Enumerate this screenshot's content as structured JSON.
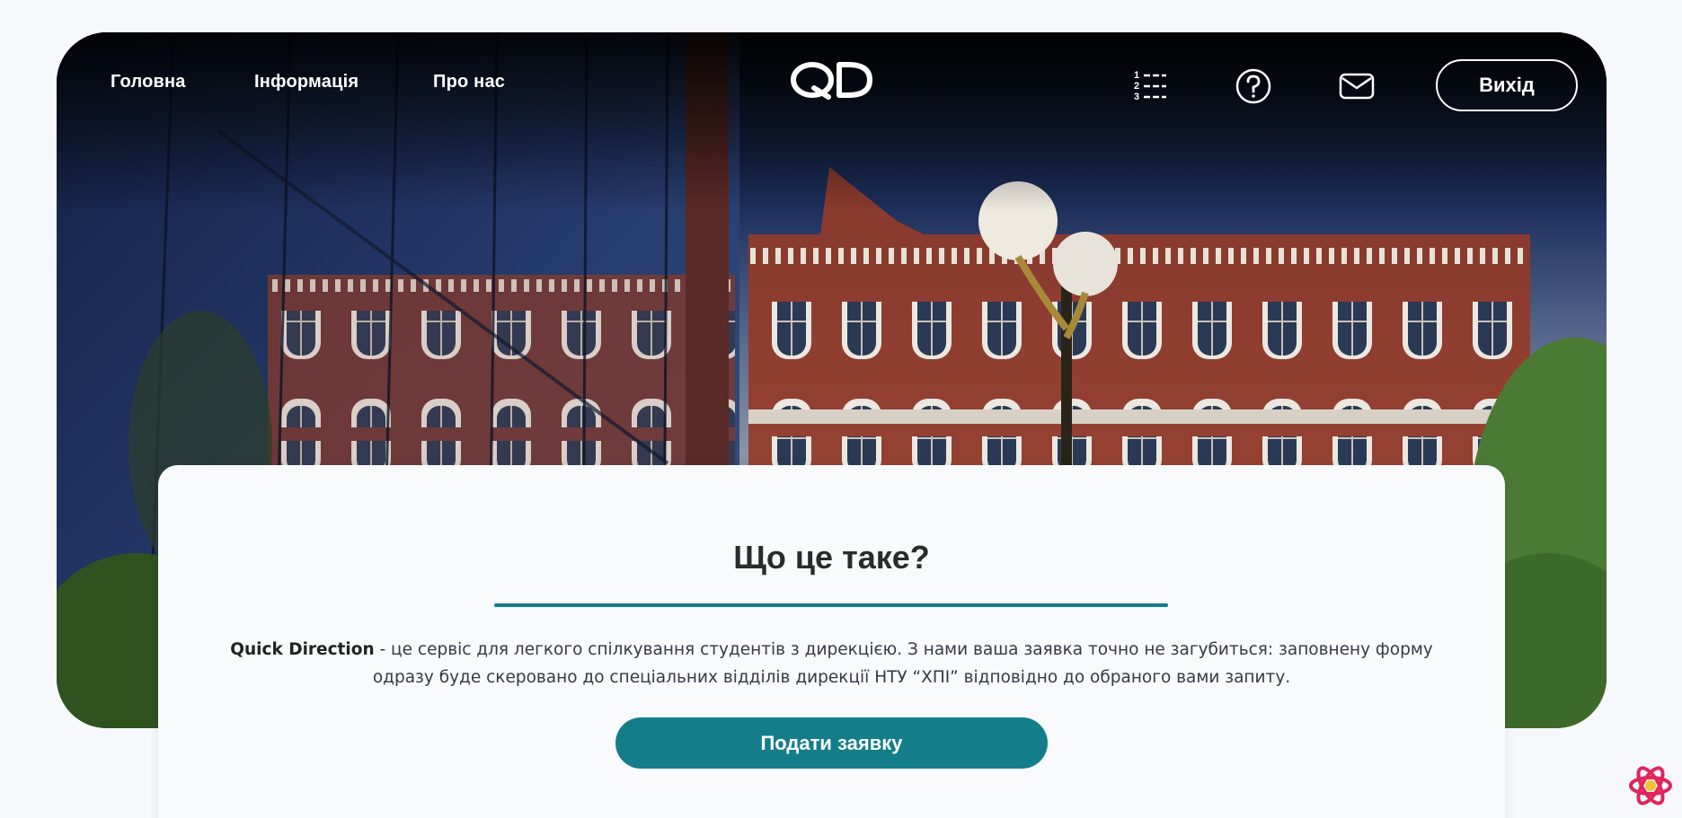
{
  "nav": {
    "home": "Головна",
    "info": "Інформація",
    "about": "Про нас",
    "logo": "QD",
    "logout": "Вихід"
  },
  "icons": {
    "list": "numbered-list-icon",
    "help": "question-icon",
    "mail": "mail-icon"
  },
  "hero": {
    "image": "university-building-photo"
  },
  "card": {
    "title": "Що це таке?",
    "brand": "Quick Direction",
    "description": " - це сервіс для легкого спілкування студентів з дирекцією. З нами ваша заявка точно не загубиться: заповнену форму одразу буде скеровано до спеціальних відділів дирекції НТУ “ХПІ” відповідно до обраного вами запиту.",
    "cta": "Подати заявку"
  },
  "colors": {
    "accent": "#137e8a",
    "page_bg": "#f6f8fb",
    "card_bg": "#f8fafc"
  }
}
